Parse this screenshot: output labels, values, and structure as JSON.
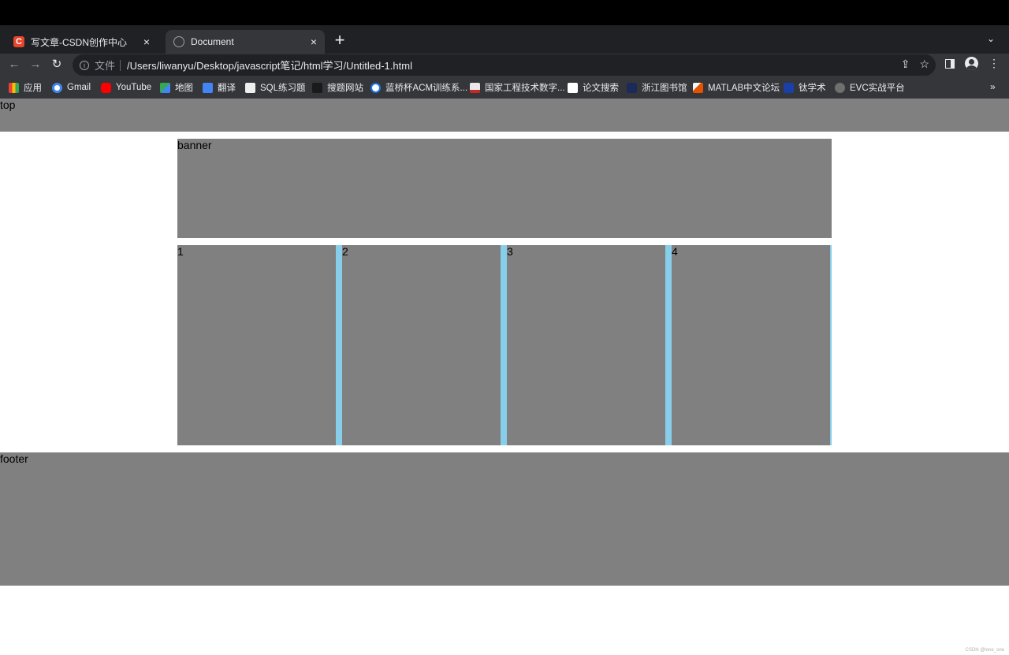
{
  "browser": {
    "tabs": [
      {
        "title": "写文章-CSDN创作中心",
        "favicon": "csdn-icon",
        "active": false
      },
      {
        "title": "Document",
        "favicon": "globe-icon",
        "active": true
      }
    ],
    "close_glyph": "×",
    "new_tab_glyph": "+",
    "tab_menu_glyph": "⌄",
    "address": {
      "scheme_label": "文件",
      "url": "/Users/liwanyu/Desktop/javascript笔记/html学习/Untitled-1.html"
    },
    "bookmarks": [
      {
        "label": "应用",
        "icon": "apps-grid-icon"
      },
      {
        "label": "Gmail",
        "icon": "google-icon"
      },
      {
        "label": "YouTube",
        "icon": "youtube-icon"
      },
      {
        "label": "地图",
        "icon": "maps-icon"
      },
      {
        "label": "翻译",
        "icon": "translate-icon"
      },
      {
        "label": "SQL练习题",
        "icon": "sql-icon"
      },
      {
        "label": "搜题网站",
        "icon": "search-site-icon"
      },
      {
        "label": "蓝桥杯ACM训练系...",
        "icon": "lanqiao-icon"
      },
      {
        "label": "国家工程技术数字...",
        "icon": "gov-tech-icon"
      },
      {
        "label": "论文搜索",
        "icon": "paper-search-icon"
      },
      {
        "label": "浙江图书馆",
        "icon": "library-icon"
      },
      {
        "label": "MATLAB中文论坛",
        "icon": "matlab-icon"
      },
      {
        "label": "钛学术",
        "icon": "ti-academic-icon"
      },
      {
        "label": "EVC实战平台",
        "icon": "globe-icon"
      }
    ],
    "bookmarks_more": "»"
  },
  "page": {
    "top_label": "top",
    "banner_label": "banner",
    "boxes": [
      "1",
      "2",
      "3",
      "4"
    ],
    "footer_label": "footer",
    "watermark": "CSDN @lone_one"
  },
  "colors": {
    "block_gray": "#808080",
    "gap_blue": "#87ceeb",
    "chrome_dark": "#202124",
    "chrome_toolbar": "#35363a"
  }
}
